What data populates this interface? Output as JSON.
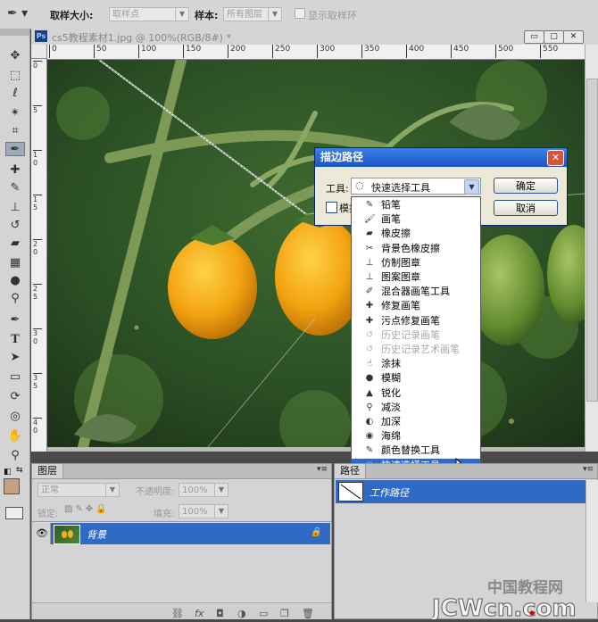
{
  "options_bar": {
    "sample_size_label": "取样大小:",
    "sample_size_value": "取样点",
    "sample_label": "样本:",
    "sample_value": "所有图层",
    "show_ring_label": "显示取样环"
  },
  "document": {
    "ps_badge": "Ps",
    "title": "cs5教程素材1.jpg @ 100%(RGB/8#) *",
    "ruler_top_ticks": [
      "0",
      "50",
      "100",
      "150",
      "200",
      "250",
      "300",
      "350",
      "400",
      "450",
      "500",
      "550"
    ],
    "ruler_left_ticks": [
      "0",
      "5",
      "1 0",
      "1 5",
      "2 0",
      "2 5",
      "3 0",
      "3 5",
      "4 0"
    ],
    "win_min": "▭",
    "win_max": "▢",
    "win_close": "✕"
  },
  "dialog": {
    "title": "描边路径",
    "tool_label": "工具:",
    "tool_value": "快速选择工具",
    "simulate_label": "模拟压力",
    "ok": "确定",
    "cancel": "取消",
    "close": "✕"
  },
  "tool_list": [
    {
      "label": "铅笔",
      "icon": "pencil-icon",
      "glyph": "✎",
      "disabled": false
    },
    {
      "label": "画笔",
      "icon": "brush-icon",
      "glyph": "🖌",
      "disabled": false
    },
    {
      "label": "橡皮擦",
      "icon": "eraser-icon",
      "glyph": "▰",
      "disabled": false
    },
    {
      "label": "背景色橡皮擦",
      "icon": "background-eraser-icon",
      "glyph": "✂",
      "disabled": false
    },
    {
      "label": "仿制图章",
      "icon": "clone-stamp-icon",
      "glyph": "⊥",
      "disabled": false
    },
    {
      "label": "图案图章",
      "icon": "pattern-stamp-icon",
      "glyph": "⊥",
      "disabled": false
    },
    {
      "label": "混合器画笔工具",
      "icon": "mixer-brush-icon",
      "glyph": "✐",
      "disabled": false
    },
    {
      "label": "修复画笔",
      "icon": "healing-brush-icon",
      "glyph": "✚",
      "disabled": false
    },
    {
      "label": "污点修复画笔",
      "icon": "spot-healing-icon",
      "glyph": "✚",
      "disabled": false
    },
    {
      "label": "历史记录画笔",
      "icon": "history-brush-icon",
      "glyph": "↺",
      "disabled": true
    },
    {
      "label": "历史记录艺术画笔",
      "icon": "art-history-brush-icon",
      "glyph": "↺",
      "disabled": true
    },
    {
      "label": "涂抹",
      "icon": "smudge-icon",
      "glyph": "☝",
      "disabled": false
    },
    {
      "label": "模糊",
      "icon": "blur-icon",
      "glyph": "●",
      "disabled": false
    },
    {
      "label": "锐化",
      "icon": "sharpen-icon",
      "glyph": "▲",
      "disabled": false
    },
    {
      "label": "减淡",
      "icon": "dodge-icon",
      "glyph": "⚲",
      "disabled": false
    },
    {
      "label": "加深",
      "icon": "burn-icon",
      "glyph": "◐",
      "disabled": false
    },
    {
      "label": "海绵",
      "icon": "sponge-icon",
      "glyph": "◉",
      "disabled": false
    },
    {
      "label": "颜色替换工具",
      "icon": "color-replacement-icon",
      "glyph": "✎",
      "disabled": false
    },
    {
      "label": "快速选择工具",
      "icon": "quick-selection-icon",
      "glyph": "◌",
      "disabled": false
    }
  ],
  "layers_panel": {
    "tab": "图层",
    "blend_mode": "正常",
    "opacity_label": "不透明度:",
    "opacity_value": "100%",
    "lock_label": "锁定:",
    "fill_label": "填充:",
    "fill_value": "100%",
    "layer_name": "背景"
  },
  "paths_panel": {
    "tab": "路径",
    "path_name": "工作路径"
  },
  "watermark": "中国教程网 JCWcn.com",
  "colors": {
    "accent": "#316ac5",
    "dialog_title": "#1b55c7",
    "foreground_swatch": "#c8a07a"
  }
}
